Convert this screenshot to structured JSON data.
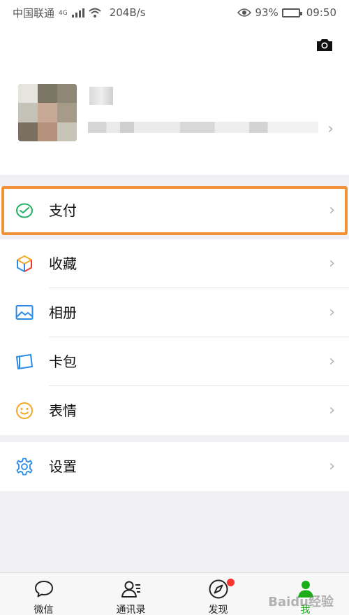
{
  "status_bar": {
    "carrier": "中国联通",
    "network": "4G",
    "speed": "204B/s",
    "battery": "93%",
    "battery_level": 0.93,
    "time": "09:50"
  },
  "profile": {
    "camera_icon": "camera-icon",
    "chevron": "›"
  },
  "menu": {
    "pay": {
      "label": "支付",
      "icon": "wallet-icon",
      "color": "#20b062"
    },
    "favorites": {
      "label": "收藏",
      "icon": "cube-icon"
    },
    "album": {
      "label": "相册",
      "icon": "image-icon",
      "color": "#2a8be8"
    },
    "cards": {
      "label": "卡包",
      "icon": "card-icon",
      "color": "#2a8be8"
    },
    "stickers": {
      "label": "表情",
      "icon": "smile-icon",
      "color": "#f5a623"
    },
    "settings": {
      "label": "设置",
      "icon": "gear-icon",
      "color": "#2a8be8"
    },
    "chevron": "›"
  },
  "highlight_color": "#f0923a",
  "tabbar": {
    "tabs": [
      {
        "label": "微信",
        "icon": "chat-bubble-icon"
      },
      {
        "label": "通讯录",
        "icon": "contacts-icon"
      },
      {
        "label": "发现",
        "icon": "compass-icon",
        "badge": true
      },
      {
        "label": "我",
        "icon": "person-icon",
        "active": true
      }
    ],
    "active_color": "#1aad19"
  },
  "watermark": "Baidu经验"
}
